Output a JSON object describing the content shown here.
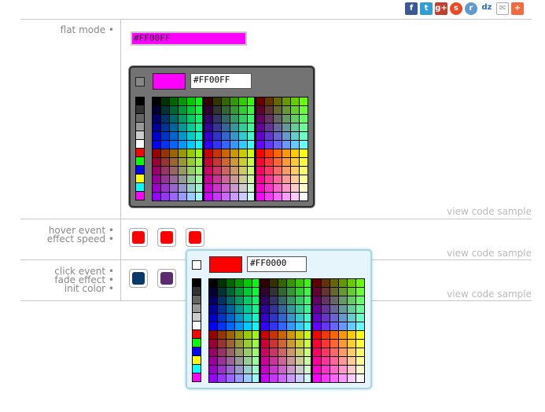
{
  "share": [
    {
      "name": "facebook-icon",
      "glyph": "f",
      "color": "#3b5998"
    },
    {
      "name": "twitter-icon",
      "glyph": "t",
      "color": "#2f9fd6"
    },
    {
      "name": "googleplus-icon",
      "glyph": "g+",
      "color": "#c63d2d"
    },
    {
      "name": "stumbleupon-icon",
      "glyph": "s",
      "color": "#eb4924"
    },
    {
      "name": "reddit-icon",
      "glyph": "r",
      "color": "#5f99cf"
    },
    {
      "name": "dzone-icon",
      "glyph": "dz",
      "color": "#ffffff"
    },
    {
      "name": "email-icon",
      "glyph": "✉",
      "color": "#ffffff"
    },
    {
      "name": "share-more-icon",
      "glyph": "+",
      "color": "#f26a3e"
    }
  ],
  "rows": {
    "flat": {
      "labels": [
        "flat mode •"
      ],
      "link": "view code sample"
    },
    "hover": {
      "labels": [
        "hover event •",
        "effect speed •"
      ],
      "link": "view code sample"
    },
    "click": {
      "labels": [
        "click event •",
        "fade effect •",
        "init color •"
      ],
      "link": "view code sample"
    }
  },
  "flat_input_value": "#FF00FF",
  "flat_picker": {
    "hex": "#FF00FF",
    "color": "#ff00ff"
  },
  "popup_picker": {
    "hex": "#FF0000",
    "color": "#ff0000"
  },
  "triggers_hover": [
    "#ff0000",
    "#ff0000",
    "#ff0000"
  ],
  "triggers_click": [
    "#0a3a6b",
    "#5b2c6f"
  ],
  "palette_columns": [
    "#000000",
    "#333333",
    "#666666",
    "#999999",
    "#cccccc",
    "#ffffff",
    "#ff0000",
    "#00ff00",
    "#0000ff",
    "#ffff00",
    "#00ffff",
    "#ff00ff"
  ]
}
